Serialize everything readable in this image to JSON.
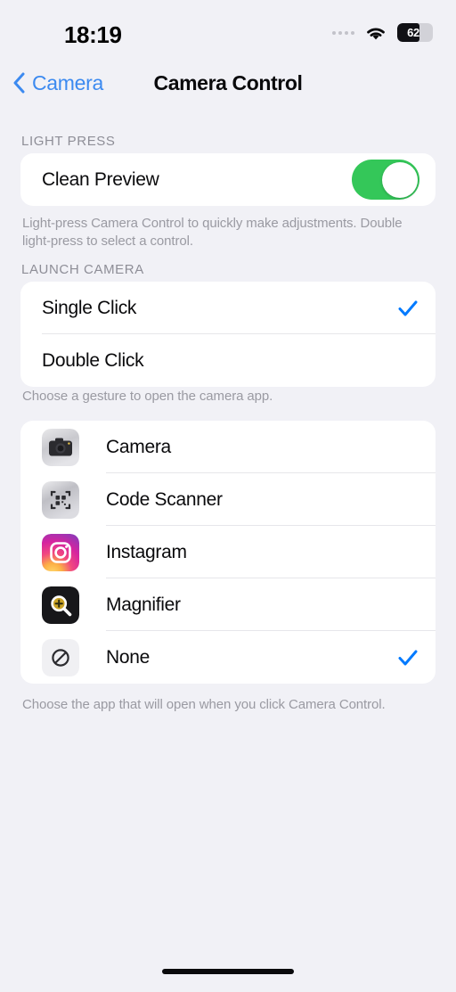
{
  "status_bar": {
    "time": "18:19",
    "battery_percent": "62",
    "battery_level": 62,
    "wifi_icon": "wifi-icon",
    "signal_icon": "signal-dots-icon"
  },
  "nav": {
    "back_label": "Camera",
    "back_icon": "chevron-left-icon",
    "title": "Camera Control"
  },
  "sections": {
    "light_press": {
      "header": "LIGHT PRESS",
      "row_label": "Clean Preview",
      "toggle_state": "on",
      "footnote": "Light-press Camera Control to quickly make adjustments. Double light-press to select a control."
    },
    "launch_camera": {
      "header": "LAUNCH CAMERA",
      "options": [
        {
          "label": "Single Click",
          "selected": true
        },
        {
          "label": "Double Click",
          "selected": false
        }
      ],
      "footnote": "Choose a gesture to open the camera app."
    },
    "app_list": {
      "items": [
        {
          "label": "Camera",
          "icon": "camera-app-icon",
          "selected": false
        },
        {
          "label": "Code Scanner",
          "icon": "code-scanner-app-icon",
          "selected": false
        },
        {
          "label": "Instagram",
          "icon": "instagram-app-icon",
          "selected": false
        },
        {
          "label": "Magnifier",
          "icon": "magnifier-app-icon",
          "selected": false
        },
        {
          "label": "None",
          "icon": "none-prohibition-icon",
          "selected": true
        }
      ],
      "footnote": "Choose the app that will open when you click Camera Control."
    }
  },
  "colors": {
    "background": "#F1F1F6",
    "card": "#FFFFFF",
    "accent_blue": "#007AFF",
    "back_blue": "#3C8AF0",
    "toggle_green": "#34C759",
    "secondary_text": "#8E8E97"
  }
}
